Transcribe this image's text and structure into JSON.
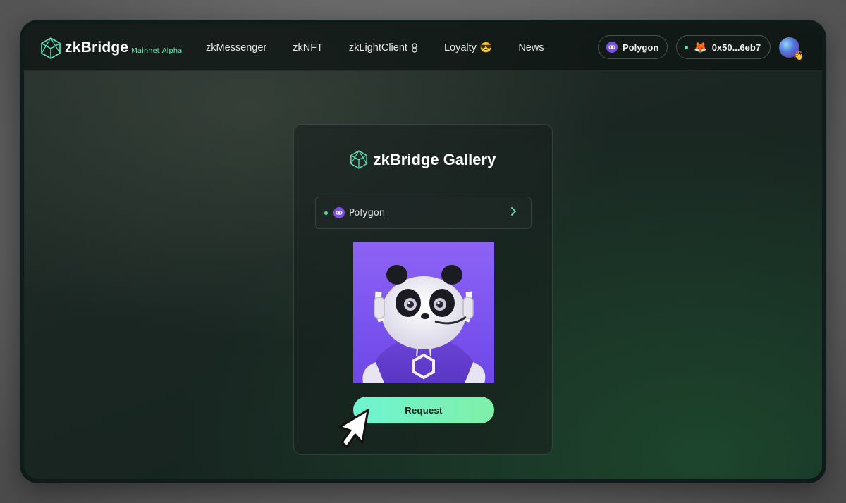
{
  "brand": {
    "name": "zkBridge",
    "subtitle": "Mainnet Alpha"
  },
  "nav": {
    "items": [
      {
        "label": "zkMessenger"
      },
      {
        "label": "zkNFT"
      },
      {
        "label": "zkLightClient",
        "icon": "link-icon"
      },
      {
        "label": "Loyalty",
        "icon": "cool-face-emoji"
      },
      {
        "label": "News"
      }
    ]
  },
  "header": {
    "network_label": "Polygon",
    "wallet_address": "0x50...6eb7",
    "wallet_status": "connected"
  },
  "gallery": {
    "title": "zkBridge Gallery",
    "chain_select": "Polygon",
    "request_label": "Request"
  },
  "colors": {
    "accent": "#6ef0b3",
    "polygon": "#7b4fe0",
    "button_start": "#6ef4d2",
    "button_end": "#7ff0a8"
  }
}
